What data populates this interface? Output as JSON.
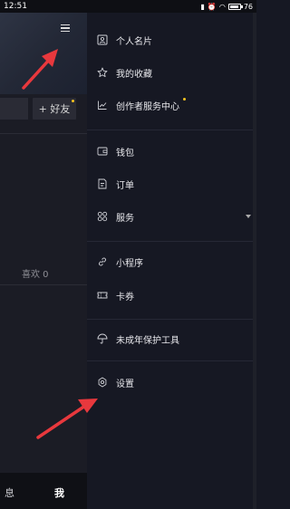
{
  "status_bar": {
    "time": "12:51",
    "battery_level": 0.76,
    "battery_text": "76"
  },
  "background_page": {
    "add_friend_label": "+ 好友",
    "likes_label": "喜欢 0",
    "nav_messages_label": "息",
    "nav_me_label": "我"
  },
  "drawer": {
    "items": [
      {
        "label": "个人名片",
        "icon": "id-card-icon"
      },
      {
        "label": "我的收藏",
        "icon": "star-icon"
      },
      {
        "label": "创作者服务中心",
        "icon": "trend-chart-icon",
        "badge_dot": true
      },
      {
        "label": "钱包",
        "icon": "wallet-icon"
      },
      {
        "label": "订单",
        "icon": "order-icon"
      },
      {
        "label": "服务",
        "icon": "grid-icon",
        "expandable": true
      },
      {
        "label": "小程序",
        "icon": "link-icon"
      },
      {
        "label": "卡券",
        "icon": "ticket-icon"
      },
      {
        "label": "未成年保护工具",
        "icon": "umbrella-icon"
      },
      {
        "label": "设置",
        "icon": "gear-icon"
      }
    ]
  },
  "colors": {
    "accent_dot": "#f5c320",
    "annotation_arrow": "#e8383d",
    "drawer_bg": "#161823"
  }
}
